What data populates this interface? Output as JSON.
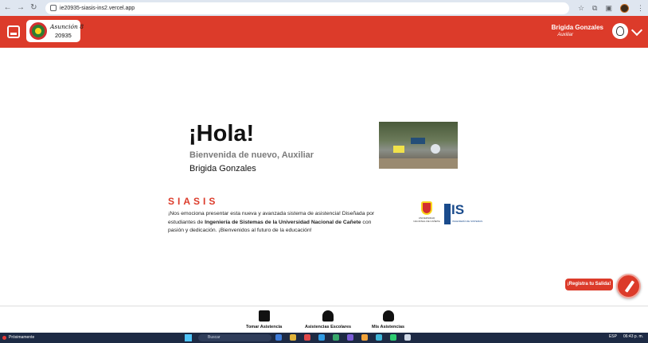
{
  "browser": {
    "url": "ie20935-siasis-ins2.vercel.app"
  },
  "header": {
    "school_name": "Asunción 8",
    "school_code": "20935",
    "user_name": "Brigida Gonzales",
    "user_role": "Auxiliar"
  },
  "main": {
    "hello": "¡Hola!",
    "welcome": "Bienvenida de nuevo, Auxiliar",
    "name": "Brigida Gonzales",
    "siasis_title": "SIASIS",
    "desc_part1": "¡Nos emociona presentar esta nueva y avanzada sistema de asistencia! Diseñada por estudiantes de ",
    "desc_bold": "Ingeniería de Sistemas de la Universidad Nacional de Cañete",
    "desc_part2": " con pasión y dedicación. ¡Bienvenidos al futuro de la educación!",
    "unc_caption": "UNIVERSIDAD NACIONAL DE CAÑETE",
    "is_logo_letters": "IS",
    "is_logo_sub": "INGENIERÍA DE SISTEMAS"
  },
  "fab": {
    "exit_label": "¡Registra tu Salida!"
  },
  "bottom_nav": {
    "items": [
      {
        "label": "Tomar Asistencia",
        "icon": "clipboard-icon"
      },
      {
        "label": "Asistencias Escolares",
        "icon": "graduate-icon"
      },
      {
        "label": "Mis Asistencias",
        "icon": "person-icon"
      }
    ]
  },
  "taskbar": {
    "weather": "Próximamente",
    "search": "Buscar",
    "lang": "ESP",
    "time": "06:43 p. m."
  },
  "colors": {
    "brand_red": "#dc3b2a"
  }
}
